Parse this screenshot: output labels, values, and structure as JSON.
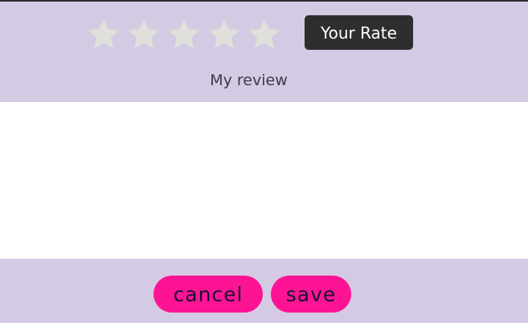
{
  "rating": {
    "max_stars": 5,
    "selected": 0,
    "star_color": "#e0e0da",
    "stars": [
      "star-1",
      "star-2",
      "star-3",
      "star-4",
      "star-5"
    ]
  },
  "rate_badge": {
    "label": "Your Rate"
  },
  "review": {
    "label": "My review",
    "value": "",
    "placeholder": ""
  },
  "actions": {
    "cancel_label": "cancel",
    "save_label": "save"
  },
  "colors": {
    "background": "#d4cae3",
    "review_area": "#ffffff",
    "badge_bg": "#2e2e2e",
    "button_accent": "#fd1495"
  }
}
